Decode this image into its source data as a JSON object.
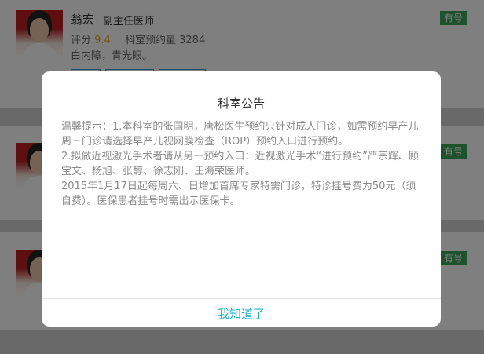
{
  "doctors": [
    {
      "name": "翁宏",
      "title": "副主任医师",
      "rating_label": "评分",
      "rating": "9.4",
      "appointments_label": "科室预约量",
      "appointments": "3284",
      "specialty": "白内障，青光眼。",
      "badge": "有号"
    },
    {
      "badge": "有号"
    },
    {
      "badge": "有号"
    }
  ],
  "dialog": {
    "title": "科室公告",
    "paragraphs": [
      "温馨提示：1.本科室的张国明，唐松医生预约只针对成人门诊，如需预约早产儿周三门诊请选择早产儿视网膜检查（ROP）预约入口进行预约。",
      "2.拟做近视激光手术者请从另一预约入口：近视激光手术“进行预约”严宗辉、顾宝文、杨旭、张醇、徐志刚、王海荣医师。",
      "2015年1月17日起每周六、日增加首席专家特需门诊，特诊挂号费为50元（须自费）。医保患者挂号时需出示医保卡。"
    ],
    "ok_label": "我知道了"
  },
  "colors": {
    "accent": "#1fb3c1",
    "badge_green": "#3aa55a",
    "rating_orange": "#f0a020"
  }
}
